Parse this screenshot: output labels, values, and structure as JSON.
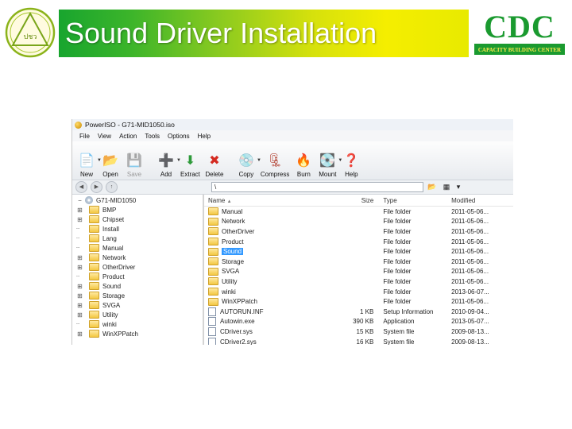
{
  "slide": {
    "title": "Sound Driver Installation",
    "left_logo_text": "ปชว",
    "cdc_logo": {
      "letters": "CDC",
      "subtitle": "CAPACITY BUILDING CENTER",
      "color": "#1a9a2f"
    },
    "banner_colors": [
      "#18a52e",
      "#f5ee00"
    ]
  },
  "window": {
    "title": "PowerISO - G71-MID1050.iso",
    "menu": [
      "File",
      "View",
      "Action",
      "Tools",
      "Options",
      "Help"
    ],
    "toolbar": [
      {
        "label": "New",
        "icon": "new-document-icon",
        "dropdown": true,
        "enabled": true
      },
      {
        "label": "Open",
        "icon": "open-folder-icon",
        "dropdown": false,
        "enabled": true
      },
      {
        "label": "Save",
        "icon": "save-disk-icon",
        "dropdown": false,
        "enabled": false
      },
      {
        "label": "Add",
        "icon": "add-plus-icon",
        "dropdown": true,
        "enabled": true
      },
      {
        "label": "Extract",
        "icon": "extract-arrow-icon",
        "dropdown": false,
        "enabled": true
      },
      {
        "label": "Delete",
        "icon": "delete-x-icon",
        "dropdown": false,
        "enabled": true
      },
      {
        "label": "Copy",
        "icon": "copy-disc-icon",
        "dropdown": true,
        "enabled": true
      },
      {
        "label": "Compress",
        "icon": "compress-icon",
        "dropdown": false,
        "enabled": true
      },
      {
        "label": "Burn",
        "icon": "burn-disc-icon",
        "dropdown": false,
        "enabled": true
      },
      {
        "label": "Mount",
        "icon": "mount-drive-icon",
        "dropdown": true,
        "enabled": true
      },
      {
        "label": "Help",
        "icon": "help-icon",
        "dropdown": false,
        "enabled": true
      }
    ],
    "address": {
      "path": "\\"
    },
    "tree": {
      "root": "G71-MID1050",
      "items": [
        {
          "label": "BMP",
          "expandable": true
        },
        {
          "label": "Chipset",
          "expandable": true
        },
        {
          "label": "Install",
          "expandable": false
        },
        {
          "label": "Lang",
          "expandable": false
        },
        {
          "label": "Manual",
          "expandable": false
        },
        {
          "label": "Network",
          "expandable": true
        },
        {
          "label": "OtherDriver",
          "expandable": true
        },
        {
          "label": "Product",
          "expandable": false
        },
        {
          "label": "Sound",
          "expandable": true
        },
        {
          "label": "Storage",
          "expandable": true
        },
        {
          "label": "SVGA",
          "expandable": true
        },
        {
          "label": "Utility",
          "expandable": true
        },
        {
          "label": "winki",
          "expandable": false
        },
        {
          "label": "WinXPPatch",
          "expandable": true
        }
      ]
    },
    "columns": {
      "name": "Name",
      "size": "Size",
      "type": "Type",
      "modified": "Modified"
    },
    "files": [
      {
        "name": "Manual",
        "size": "",
        "type": "File folder",
        "modified": "2011-05-06...",
        "kind": "folder"
      },
      {
        "name": "Network",
        "size": "",
        "type": "File folder",
        "modified": "2011-05-06...",
        "kind": "folder"
      },
      {
        "name": "OtherDriver",
        "size": "",
        "type": "File folder",
        "modified": "2011-05-06...",
        "kind": "folder"
      },
      {
        "name": "Product",
        "size": "",
        "type": "File folder",
        "modified": "2011-05-06...",
        "kind": "folder"
      },
      {
        "name": "Sound",
        "size": "",
        "type": "File folder",
        "modified": "2011-05-06...",
        "kind": "folder",
        "selected": true
      },
      {
        "name": "Storage",
        "size": "",
        "type": "File folder",
        "modified": "2011-05-06...",
        "kind": "folder"
      },
      {
        "name": "SVGA",
        "size": "",
        "type": "File folder",
        "modified": "2011-05-06...",
        "kind": "folder"
      },
      {
        "name": "Utility",
        "size": "",
        "type": "File folder",
        "modified": "2011-05-06...",
        "kind": "folder"
      },
      {
        "name": "winki",
        "size": "",
        "type": "File folder",
        "modified": "2013-06-07...",
        "kind": "folder"
      },
      {
        "name": "WinXPPatch",
        "size": "",
        "type": "File folder",
        "modified": "2011-05-06...",
        "kind": "folder"
      },
      {
        "name": "AUTORUN.INF",
        "size": "1 KB",
        "type": "Setup Information",
        "modified": "2010-09-04...",
        "kind": "file"
      },
      {
        "name": "Autowin.exe",
        "size": "390 KB",
        "type": "Application",
        "modified": "2013-05-07...",
        "kind": "file"
      },
      {
        "name": "CDriver.sys",
        "size": "15 KB",
        "type": "System file",
        "modified": "2009-08-13...",
        "kind": "file"
      },
      {
        "name": "CDriver2.sys",
        "size": "16 KB",
        "type": "System file",
        "modified": "2009-08-13...",
        "kind": "file"
      }
    ]
  }
}
